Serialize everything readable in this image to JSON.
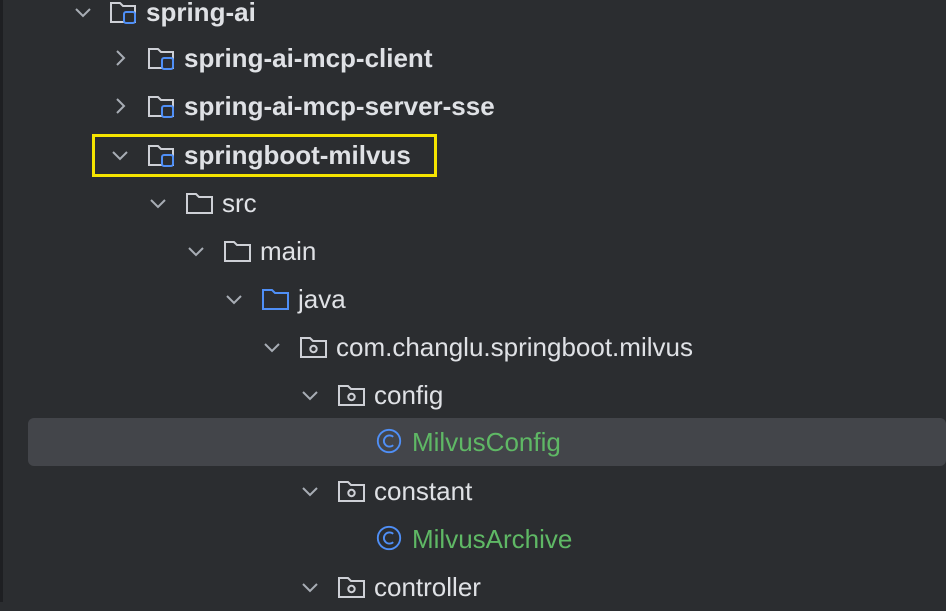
{
  "colors": {
    "background": "#2b2d30",
    "selection": "#43454a",
    "highlight_border": "#f5e400",
    "class_green": "#5fb865",
    "java_folder_blue": "#4f8ff7",
    "module_blue": "#4f8ff7"
  },
  "tree": {
    "items": [
      {
        "label": "spring-ai",
        "icon": "module-folder-icon",
        "chevron": "chevron-down-icon",
        "bold": true
      },
      {
        "label": "spring-ai-mcp-client",
        "icon": "module-folder-icon",
        "chevron": "chevron-right-icon",
        "bold": true
      },
      {
        "label": "spring-ai-mcp-server-sse",
        "icon": "module-folder-icon",
        "chevron": "chevron-right-icon",
        "bold": true
      },
      {
        "label": "springboot-milvus",
        "icon": "module-folder-icon",
        "chevron": "chevron-down-icon",
        "bold": true,
        "highlighted": true
      },
      {
        "label": "src",
        "icon": "folder-icon",
        "chevron": "chevron-down-icon"
      },
      {
        "label": "main",
        "icon": "folder-icon",
        "chevron": "chevron-down-icon"
      },
      {
        "label": "java",
        "icon": "source-folder-icon",
        "chevron": "chevron-down-icon"
      },
      {
        "label": "com.changlu.springboot.milvus",
        "icon": "package-icon",
        "chevron": "chevron-down-icon"
      },
      {
        "label": "config",
        "icon": "package-icon",
        "chevron": "chevron-down-icon"
      },
      {
        "label": "MilvusConfig",
        "icon": "class-icon",
        "selected": true
      },
      {
        "label": "constant",
        "icon": "package-icon",
        "chevron": "chevron-down-icon"
      },
      {
        "label": "MilvusArchive",
        "icon": "class-icon"
      },
      {
        "label": "controller",
        "icon": "package-icon",
        "chevron": "chevron-down-icon"
      }
    ]
  }
}
